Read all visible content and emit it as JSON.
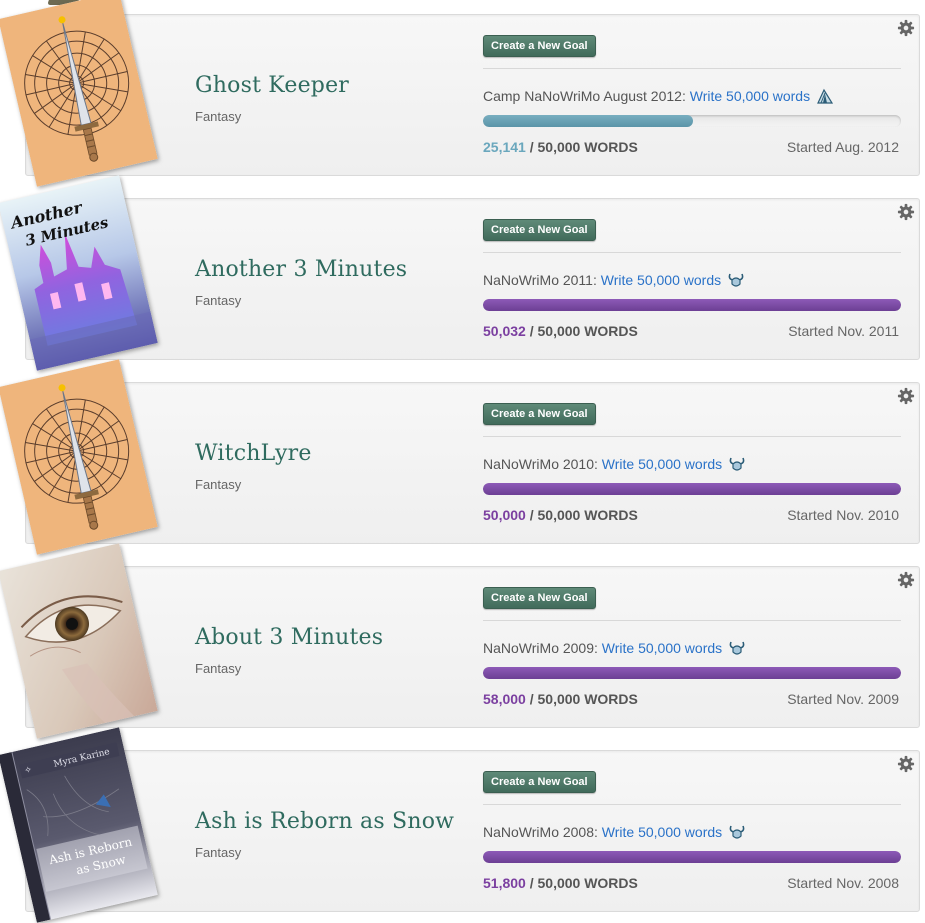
{
  "create_goal_label": "Create a New Goal",
  "words_suffix": "/ 50,000 WORDS",
  "colors": {
    "title": "#2f6b5f",
    "link": "#2a72c8",
    "camp_bar": "#5a94a8",
    "nano_bar": "#6c3f94"
  },
  "novels": [
    {
      "title": "Ghost Keeper",
      "genre": "Fantasy",
      "event_prefix": "Camp NaNoWriMo August 2012:",
      "goal_link": "Write 50,000 words",
      "event_icon": "tent-icon",
      "progress_fraction": 0.503,
      "word_count": "25,141",
      "started": "Started Aug. 2012",
      "cover": "sword-compass"
    },
    {
      "title": "Another 3 Minutes",
      "genre": "Fantasy",
      "event_prefix": "NaNoWriMo 2011:",
      "goal_link": "Write 50,000 words",
      "event_icon": "viking-helmet-icon",
      "progress_fraction": 1.0,
      "word_count": "50,032",
      "started": "Started Nov. 2011",
      "cover": "castle",
      "cover_text": [
        "Another",
        "3 Minutes"
      ]
    },
    {
      "title": "WitchLyre",
      "genre": "Fantasy",
      "event_prefix": "NaNoWriMo 2010:",
      "goal_link": "Write 50,000 words",
      "event_icon": "viking-helmet-icon",
      "progress_fraction": 1.0,
      "word_count": "50,000",
      "started": "Started Nov. 2010",
      "cover": "sword-compass"
    },
    {
      "title": "About 3 Minutes",
      "genre": "Fantasy",
      "event_prefix": "NaNoWriMo 2009:",
      "goal_link": "Write 50,000 words",
      "event_icon": "viking-helmet-icon",
      "progress_fraction": 1.0,
      "word_count": "58,000",
      "started": "Started Nov. 2009",
      "cover": "eye"
    },
    {
      "title": "Ash is Reborn as Snow",
      "genre": "Fantasy",
      "event_prefix": "NaNoWriMo 2008:",
      "goal_link": "Write 50,000 words",
      "event_icon": "viking-helmet-icon",
      "progress_fraction": 1.0,
      "word_count": "51,800",
      "started": "Started Nov. 2008",
      "cover": "ash-book",
      "cover_text": [
        "Myra Karine",
        "Ash is Reborn",
        "as Snow"
      ]
    }
  ]
}
